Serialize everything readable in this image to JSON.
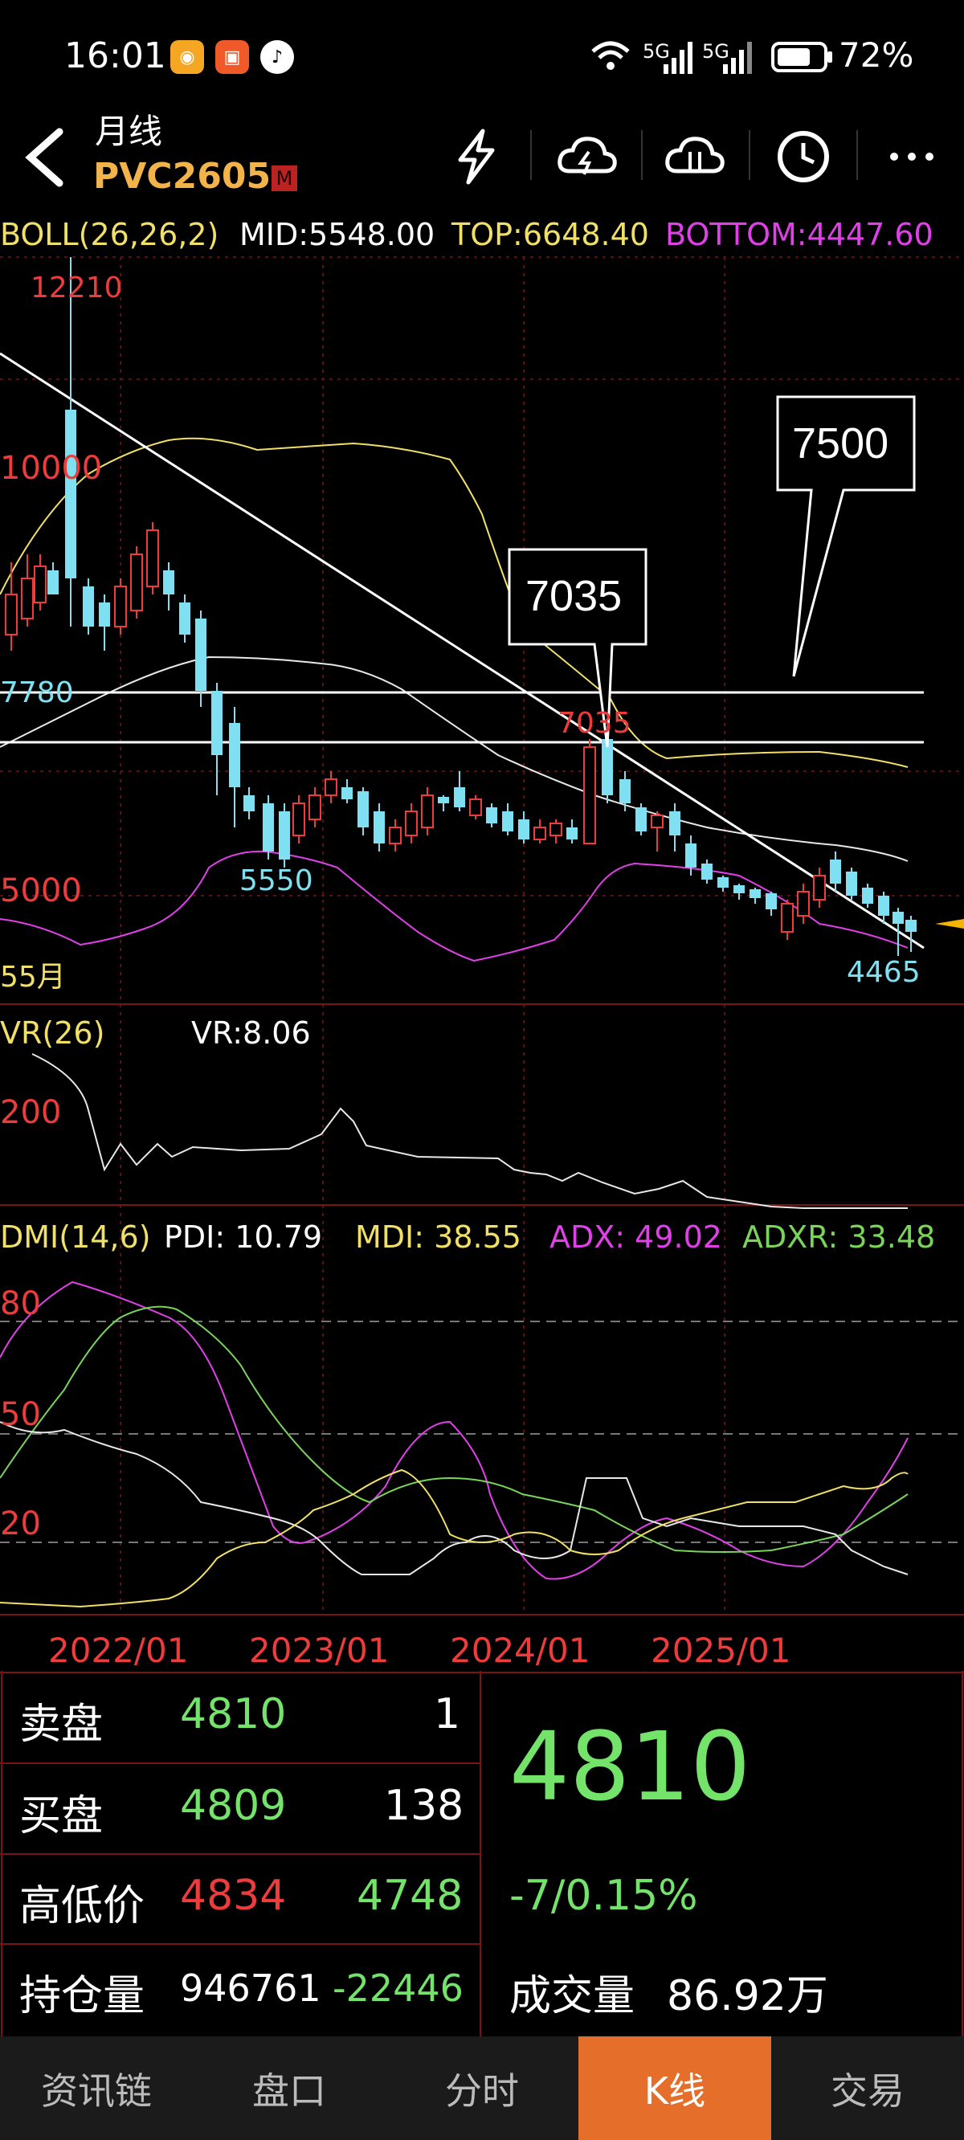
{
  "status_bar": {
    "time": "16:01",
    "network": "5G",
    "network2": "5G",
    "battery": "72%"
  },
  "header": {
    "back_icon": "back-chevron-icon",
    "period": "月线",
    "symbol": "PVC2605",
    "market_badge": "M",
    "icons": [
      "lightning-icon",
      "cloud-up-icon",
      "cloud-down-icon",
      "clock-icon",
      "more-icon"
    ]
  },
  "boll": {
    "name": "BOLL(26,26,2)",
    "mid": "MID:5548.00",
    "top": "TOP:6648.40",
    "bottom": "BOTTOM:4447.60"
  },
  "chart_labels": {
    "high": "12210",
    "y10000": "10000",
    "y7780": "7780",
    "y5000": "5000",
    "low5550": "5550",
    "marker7035": "7035",
    "low4465": "4465",
    "ma_label": "55月",
    "callout1": "7035",
    "callout2": "7500"
  },
  "vr": {
    "name": "VR(26)",
    "value": "VR:8.06",
    "axis": "200"
  },
  "dmi": {
    "name": "DMI(14,6)",
    "pdi": "PDI: 10.79",
    "mdi": "MDI: 38.55",
    "adx": "ADX: 49.02",
    "adxr": "ADXR: 33.48",
    "axis": [
      "80",
      "50",
      "20"
    ]
  },
  "x_axis": [
    "2022/01",
    "2023/01",
    "2024/01",
    "2025/01"
  ],
  "colors": {
    "up": "#ee3b3b",
    "down": "#7ee0f0",
    "mid": "#f0e068",
    "bottom": "#e040e8",
    "accent": "#e46e2a"
  },
  "quote": {
    "ask_label": "卖盘",
    "ask_price": "4810",
    "ask_vol": "1",
    "bid_label": "买盘",
    "bid_price": "4809",
    "bid_vol": "138",
    "hl_label": "高低价",
    "high": "4834",
    "low": "4748",
    "oi_label": "持仓量",
    "oi": "946761",
    "oi_change": "-22446",
    "last": "4810",
    "change": "-7/0.15%",
    "volume_label": "成交量",
    "volume": "86.92万"
  },
  "tabs": [
    {
      "label": "资讯链",
      "active": false
    },
    {
      "label": "盘口",
      "active": false
    },
    {
      "label": "分时",
      "active": false
    },
    {
      "label": "K线",
      "active": true
    },
    {
      "label": "交易",
      "active": false
    }
  ]
}
